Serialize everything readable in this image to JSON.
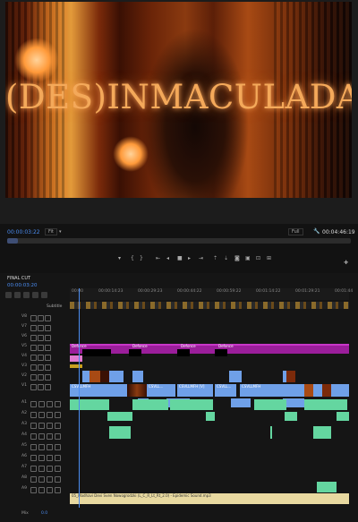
{
  "monitor": {
    "title_overlay": "(DES)INMACULADA",
    "timecode_current": "00:00:03:22",
    "fit_label": "Fit",
    "full_label": "Full",
    "timecode_duration": "00:04:46:19",
    "playback_progress": 0.03
  },
  "timeline": {
    "tab_title": "FINAL CUT",
    "timecode": "00:00:03:20",
    "subtitle_label": "Subtitle",
    "ruler": [
      "00:00",
      "00:00:14:23",
      "00:00:29:23",
      "00:00:44:22",
      "00:00:59:22",
      "00:01:14:22",
      "00:01:29:21",
      "00:01:44"
    ],
    "tracks_video": [
      "V8",
      "V7",
      "V6",
      "V5",
      "V4",
      "V3",
      "V2",
      "V1"
    ],
    "tracks_audio": [
      "A1",
      "A2",
      "A3",
      "A4",
      "A5",
      "A6",
      "A7",
      "A8",
      "A9"
    ],
    "mix_label": "Mix",
    "mix_value": "0.0",
    "subtitle_clips": [
      "Defonce",
      "Defonce",
      "Defonce",
      "Defonce"
    ],
    "v2_clips": [
      "CSVLLMFH",
      "CSVLL...",
      "CSVLLMFH [V]",
      "CSVLL...",
      "CSVLLMFH"
    ],
    "music_clip": "05_Madhavi Devi Sven Nowogrodzki (L_C_R_Lt_Rt_2.0) - Epidemic Sound.mp3",
    "colors": {
      "subtitle": "#9b1e9b",
      "video": "#6fa0e8",
      "audio": "#64d6a0",
      "music": "#e8d9a0",
      "playhead": "#4b8cf0"
    }
  }
}
